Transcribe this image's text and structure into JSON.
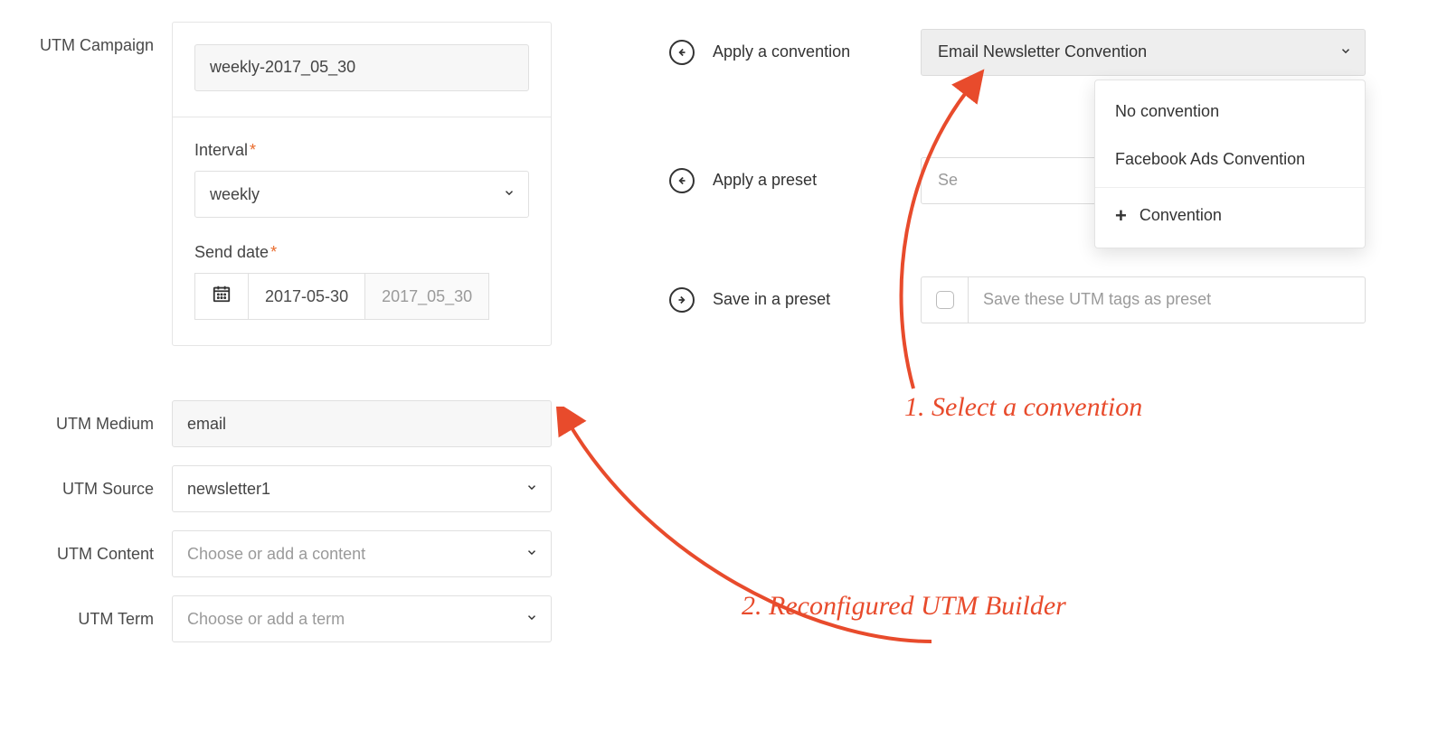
{
  "left": {
    "campaign": {
      "label": "UTM Campaign",
      "value": "weekly-2017_05_30",
      "interval_label": "Interval",
      "interval_value": "weekly",
      "send_date_label": "Send date",
      "send_date_value": "2017-05-30",
      "send_date_output": "2017_05_30"
    },
    "medium": {
      "label": "UTM Medium",
      "value": "email"
    },
    "source": {
      "label": "UTM Source",
      "value": "newsletter1"
    },
    "content": {
      "label": "UTM Content",
      "placeholder": "Choose or add a content"
    },
    "term": {
      "label": "UTM Term",
      "placeholder": "Choose or add a term"
    }
  },
  "right": {
    "apply_convention": {
      "label": "Apply a convention",
      "selected": "Email Newsletter Convention",
      "options": {
        "none": "No convention",
        "fb": "Facebook Ads Convention",
        "add": "Convention"
      }
    },
    "apply_preset": {
      "label": "Apply a preset",
      "placeholder_visible": "Se"
    },
    "save_preset": {
      "label": "Save in a preset",
      "placeholder": "Save these UTM tags as preset"
    }
  },
  "annotations": {
    "step1": "1. Select a convention",
    "step2": "2. Reconfigured UTM Builder"
  }
}
